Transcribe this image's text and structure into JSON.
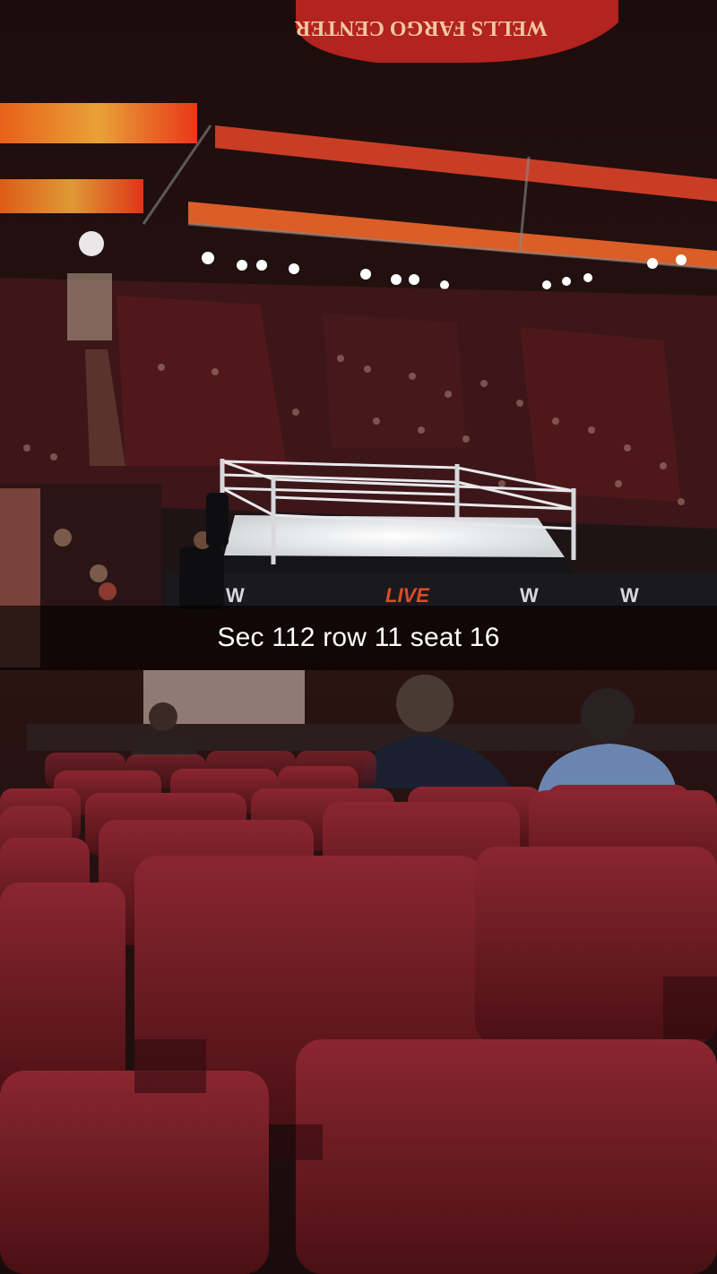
{
  "photo": {
    "scoreboard_text": "WELLS FARGO CENTER",
    "ring_brand": "W",
    "event_text": "LIVE"
  },
  "caption": {
    "text": "Sec 112 row 11 seat 16"
  },
  "colors": {
    "seat_red": "#7a1c22",
    "ring_white": "#f2f2f2",
    "caption_bg": "#000000"
  }
}
